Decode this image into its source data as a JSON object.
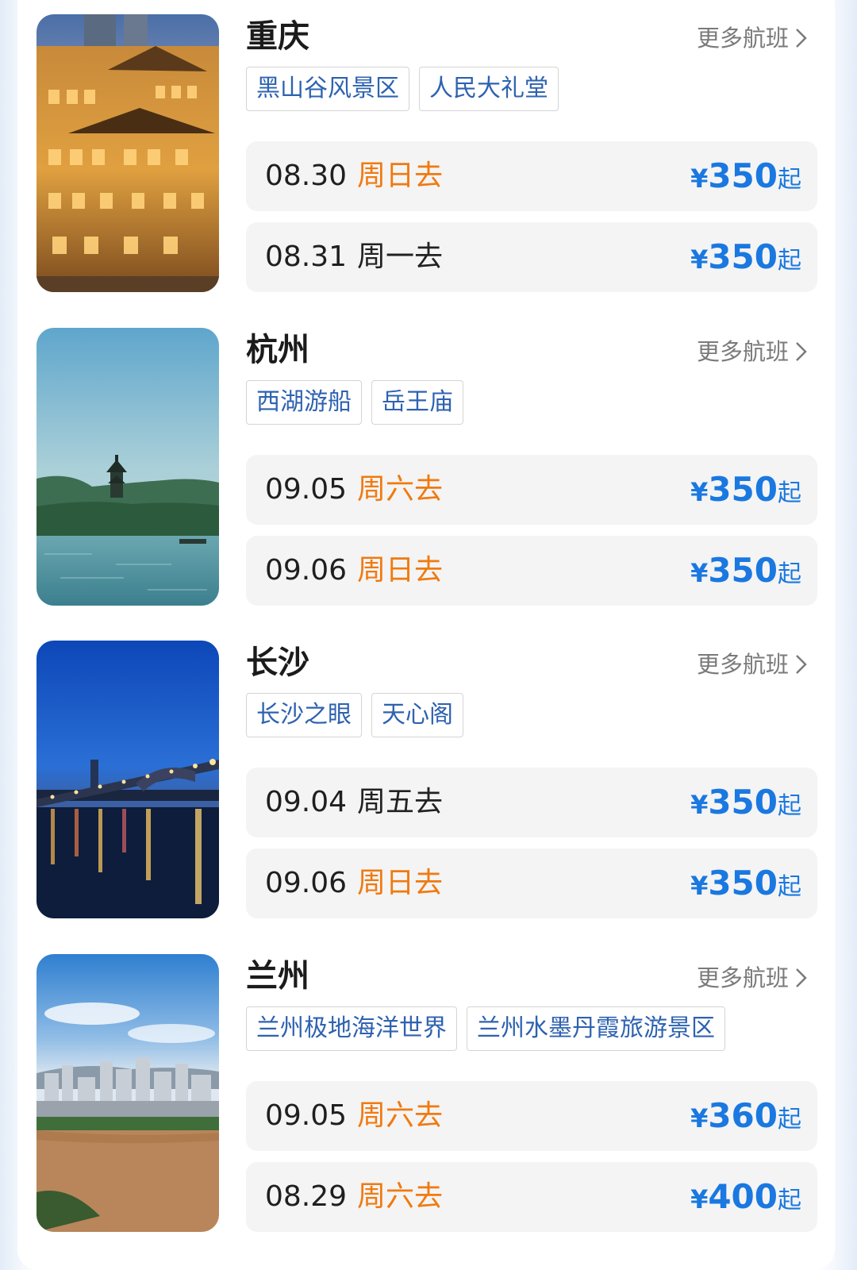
{
  "common": {
    "more_label": "更多航班",
    "currency": "¥",
    "from_suffix": "起"
  },
  "colors": {
    "price": "#1a78e0",
    "weekend_highlight": "#f07a10",
    "tag_text": "#2e62b0",
    "row_bg": "#f4f4f4"
  },
  "destinations": [
    {
      "city": "重庆",
      "image": "chongqing-hongyadong-night-photo",
      "tags": [
        "黑山谷风景区",
        "人民大礼堂"
      ],
      "flights": [
        {
          "date": "08.30",
          "weekday": "周日去",
          "highlight": true,
          "price": "350"
        },
        {
          "date": "08.31",
          "weekday": "周一去",
          "highlight": false,
          "price": "350"
        }
      ]
    },
    {
      "city": "杭州",
      "image": "hangzhou-west-lake-pagoda-photo",
      "tags": [
        "西湖游船",
        "岳王庙"
      ],
      "flights": [
        {
          "date": "09.05",
          "weekday": "周六去",
          "highlight": true,
          "price": "350"
        },
        {
          "date": "09.06",
          "weekday": "周日去",
          "highlight": true,
          "price": "350"
        }
      ]
    },
    {
      "city": "长沙",
      "image": "changsha-bridge-night-photo",
      "tags": [
        "长沙之眼",
        "天心阁"
      ],
      "flights": [
        {
          "date": "09.04",
          "weekday": "周五去",
          "highlight": false,
          "price": "350"
        },
        {
          "date": "09.06",
          "weekday": "周日去",
          "highlight": true,
          "price": "350"
        }
      ]
    },
    {
      "city": "兰州",
      "image": "lanzhou-yellow-river-city-photo",
      "tags": [
        "兰州极地海洋世界",
        "兰州水墨丹霞旅游景区"
      ],
      "flights": [
        {
          "date": "09.05",
          "weekday": "周六去",
          "highlight": true,
          "price": "360"
        },
        {
          "date": "08.29",
          "weekday": "周六去",
          "highlight": true,
          "price": "400"
        }
      ]
    }
  ]
}
